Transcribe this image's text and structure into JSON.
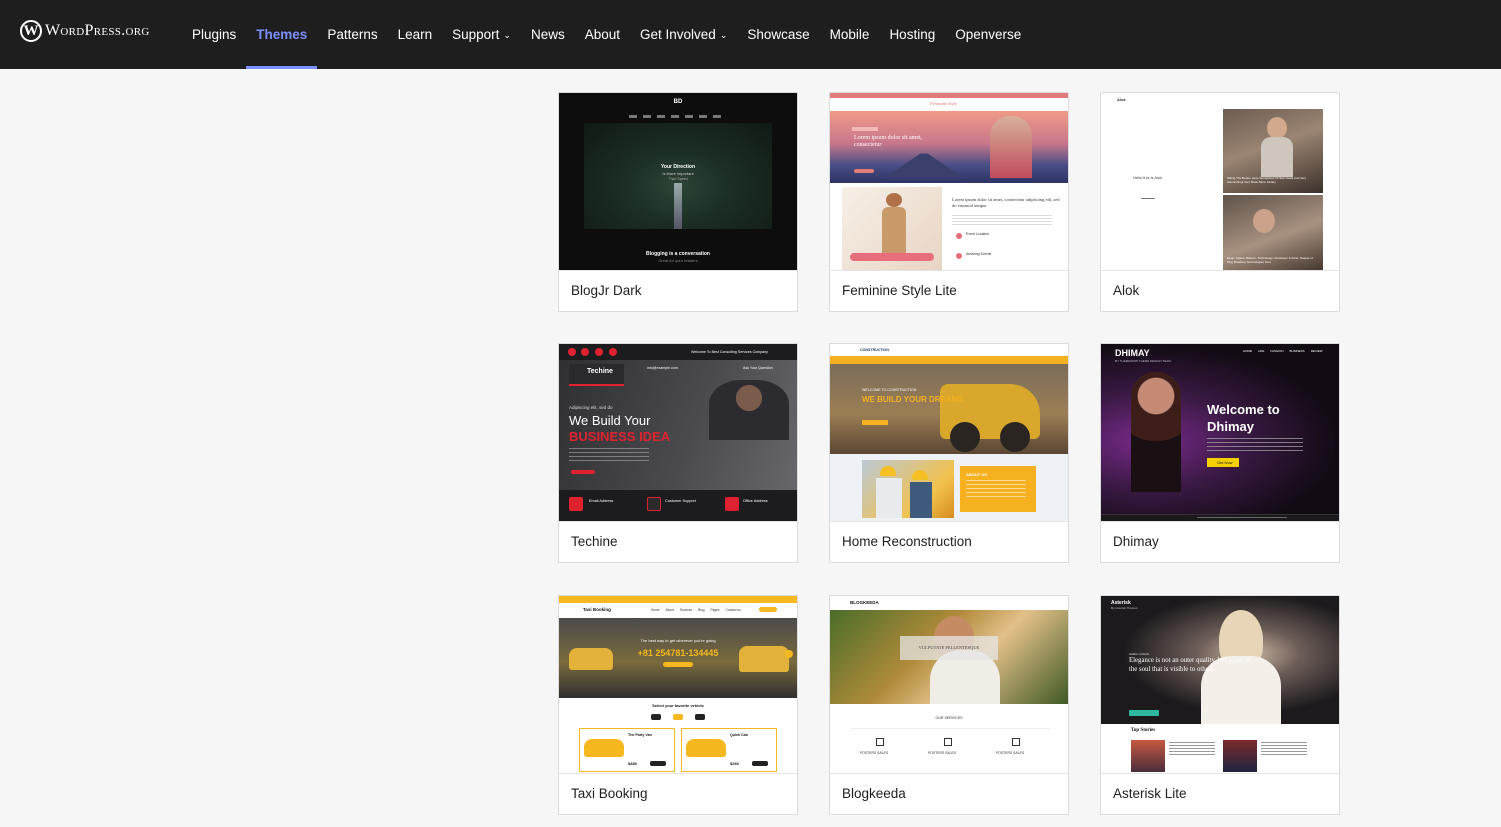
{
  "header": {
    "logo_mark": "W",
    "logo_text": "WordPress.org",
    "nav": [
      {
        "label": "Plugins",
        "active": false,
        "dropdown": false
      },
      {
        "label": "Themes",
        "active": true,
        "dropdown": false
      },
      {
        "label": "Patterns",
        "active": false,
        "dropdown": false
      },
      {
        "label": "Learn",
        "active": false,
        "dropdown": false
      },
      {
        "label": "Support",
        "active": false,
        "dropdown": true
      },
      {
        "label": "News",
        "active": false,
        "dropdown": false
      },
      {
        "label": "About",
        "active": false,
        "dropdown": false
      },
      {
        "label": "Get Involved",
        "active": false,
        "dropdown": true
      },
      {
        "label": "Showcase",
        "active": false,
        "dropdown": false
      },
      {
        "label": "Mobile",
        "active": false,
        "dropdown": false
      },
      {
        "label": "Hosting",
        "active": false,
        "dropdown": false
      },
      {
        "label": "Openverse",
        "active": false,
        "dropdown": false
      }
    ],
    "chevron_icon": "chevron-down-icon",
    "colors": {
      "bar": "#1e1e1e",
      "active": "#7b90ff"
    }
  },
  "themes": [
    {
      "name": "BlogJr Dark",
      "preview": {
        "logo": "BD",
        "hero_title": "Your Direction",
        "hero_line2": "Is More Important",
        "hero_line3": "Than Speed",
        "tagline": "Blogging is a conversation",
        "tagline2": "Great for your readers"
      }
    },
    {
      "name": "Feminine Style Lite",
      "preview": {
        "brand": "Feminine Style",
        "hero_title": "Lorem ipsum dolor sit amet, consectetur",
        "section_title": "Lorem ipsum dolor sit amet, consectetur adipiscing elit, sed do eiusmod tempor",
        "item1": "Event Location",
        "item2": "Amazing Events"
      }
    },
    {
      "name": "Alok",
      "preview": {
        "logo": "Alok",
        "center_text": "Hello this is Alok",
        "caption1": "Sitting The Books, Here Sometimes All Star Deals And Very Astonishing! Very Book Store Library",
        "caption2": "Deep, Space, Balloon, Technology, Developer & Artist, Sequel of Ping Breaking Technologies Sure"
      }
    },
    {
      "name": "Techine",
      "preview": {
        "topbar_text": "Welcome To Best Consulting Services Company",
        "brand": "Techine",
        "email": "info@example.com",
        "question": "Ask Your Question",
        "small_intro": "Adipiscing elit, sed do",
        "headline1": "We Build Your",
        "headline2": "BUSINESS IDEA",
        "info1": "Email Address",
        "info2": "Customer Support",
        "info3": "Office Address"
      }
    },
    {
      "name": "Home Reconstruction",
      "preview": {
        "brand": "CONSTRUCTION",
        "eyebrow": "WELCOME TO CONSTRUCTION",
        "headline": "WE BUILD YOUR DREAMS",
        "about": "ABOUT US"
      }
    },
    {
      "name": "Dhimay",
      "preview": {
        "brand": "DHIMAY",
        "brand_sub": "BY THEMEINWP THEME DESIGN TEAM",
        "menu": [
          "HOME",
          "LIFE",
          "FASHION",
          "BUSINESS",
          "REVIEW"
        ],
        "headline1": "Welcome to",
        "headline2": "Dhimay",
        "button": "Get Now"
      }
    },
    {
      "name": "Taxi Booking",
      "preview": {
        "brand": "Taxi Booking",
        "menu": [
          "Home",
          "About",
          "Services",
          "Blog",
          "Pages",
          "Contact us"
        ],
        "hero_small": "The best way to get wherever you're going",
        "phone": "+81 254781-134445",
        "select_title": "Select your favorite vehicle",
        "car1": "The Party Van",
        "car2": "Quick Cab",
        "price1": "$480",
        "price2": "$260"
      }
    },
    {
      "name": "Blogkeeda",
      "preview": {
        "brand": "BLOGKEEDA",
        "hero_box": "VULPUTATE PELLENTESQUE",
        "services": "OUR SERVICES",
        "service_label": "POSTERS SALES"
      }
    },
    {
      "name": "Asterisk Lite",
      "preview": {
        "brand": "Asterisk",
        "brand_sub": "By Asterisk Themes",
        "quote_small": "GREG LOGAN",
        "quote": "Elegance is not an outer quality, but a part of the soul that is visible to others.",
        "section": "Top Stories"
      }
    }
  ]
}
